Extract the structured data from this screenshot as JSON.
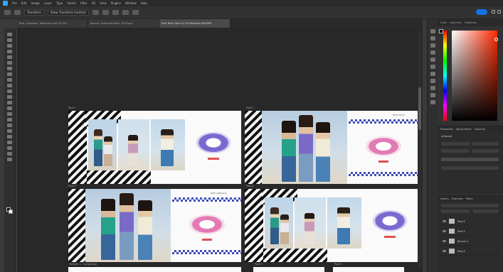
{
  "app": {
    "menu": [
      "File",
      "Edit",
      "Image",
      "Layer",
      "Type",
      "Select",
      "Filter",
      "3D",
      "View",
      "Plugins",
      "Window",
      "Help"
    ]
  },
  "options": {
    "field1": "Transform",
    "field2": "Show Transform Controls"
  },
  "tabs": [
    {
      "label": "Post_Collection_TeamSpirit.psd @ 25%"
    },
    {
      "label": "Banner_SummerEdition_2024.psd"
    },
    {
      "label": "Post Team Spirit & Oh Positively BIGGER"
    }
  ],
  "artboards": [
    {
      "label": "Post 1",
      "tag": ""
    },
    {
      "label": "Post 2",
      "tag": "NEW DROP"
    },
    {
      "label": "Post 3",
      "tag": "NEW ARRIVALS"
    },
    {
      "label": "Post 4",
      "tag": ""
    },
    {
      "label": "Banner 1 - Landscape",
      "tag": ""
    },
    {
      "label": "Post 5",
      "tag": ""
    },
    {
      "label": "Post 6",
      "tag": ""
    }
  ],
  "right_panel": {
    "color_tabs": [
      "Color",
      "Swatches",
      "Gradients"
    ],
    "properties_tabs": [
      "Properties",
      "Adjustments",
      "Libraries"
    ],
    "properties_title": "Artboard",
    "layers_tabs": [
      "Layers",
      "Channels",
      "Paths"
    ],
    "layers": [
      {
        "name": "Post 6"
      },
      {
        "name": "Post 5"
      },
      {
        "name": "Banner 1"
      },
      {
        "name": "Post 4"
      }
    ]
  },
  "colors": {
    "accent": "#1473e6",
    "checker": "#3d4db6"
  }
}
